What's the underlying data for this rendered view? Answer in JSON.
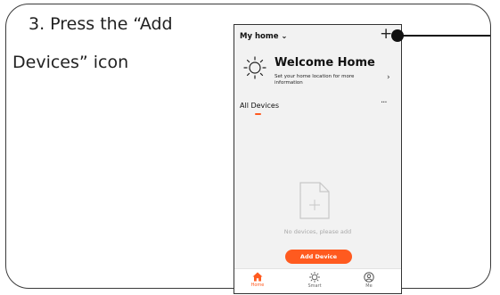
{
  "instruction": {
    "line1": "3. Press the “Add",
    "line2": "Devices” icon"
  },
  "header": {
    "home_selector": "My home ⌄",
    "add_icon": "+"
  },
  "welcome": {
    "title": "Welcome Home",
    "subtitle": "Set your home location for more information",
    "chevron": "›"
  },
  "devices": {
    "tab_label": "All Devices",
    "more_icon": "···",
    "empty_text": "No devices, please add",
    "add_button": "Add Device"
  },
  "nav": {
    "items": [
      {
        "label": "Home",
        "icon": "home-icon"
      },
      {
        "label": "Smart",
        "icon": "sun-icon"
      },
      {
        "label": "Me",
        "icon": "user-icon"
      }
    ]
  },
  "colors": {
    "accent": "#ff5a1f",
    "background": "#f2f2f2"
  }
}
